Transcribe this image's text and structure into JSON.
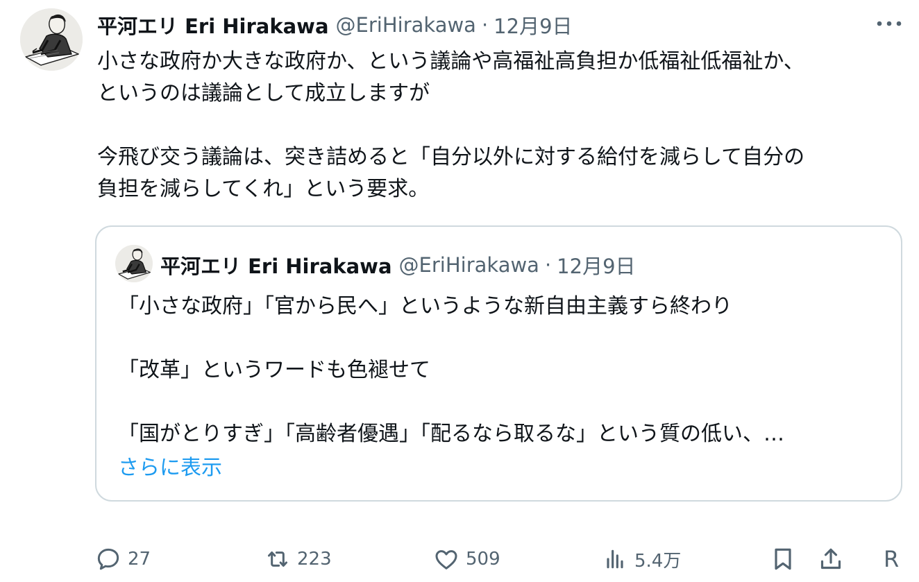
{
  "author": {
    "name": "平河エリ Eri Hirakawa",
    "handle": "@EriHirakawa",
    "separator": "·",
    "date": "12月9日"
  },
  "tweet": {
    "line1": "小さな政府か大きな政府か、という議論や高福祉高負担か低福祉低福祉か、",
    "line2": "というのは議論として成立しますが",
    "line3": "今飛び交う議論は、突き詰めると「自分以外に対する給付を減らして自分の",
    "line4": "負担を減らしてくれ」という要求。"
  },
  "quote": {
    "author_name": "平河エリ Eri Hirakawa",
    "handle": "@EriHirakawa",
    "separator": "·",
    "date": "12月9日",
    "line1": "「小さな政府」「官から民へ」というような新自由主義すら終わり",
    "line2": "「改革」というワードも色褪せて",
    "line3": "「国がとりすぎ」「高齢者優遇」「配るなら取るな」という質の低い、…",
    "show_more": "さらに表示"
  },
  "actions": {
    "replies": "27",
    "retweets": "223",
    "likes": "509",
    "views": "5.4万",
    "clipped_label": "R"
  },
  "icons": {
    "more": "more-horizontal-icon",
    "reply": "reply-icon",
    "retweet": "retweet-icon",
    "like": "heart-icon",
    "views": "views-icon",
    "bookmark": "bookmark-icon",
    "share": "share-icon"
  },
  "colors": {
    "text": "#0f1419",
    "secondary": "#536471",
    "link": "#1d9bf0",
    "border": "#cfd9de"
  }
}
